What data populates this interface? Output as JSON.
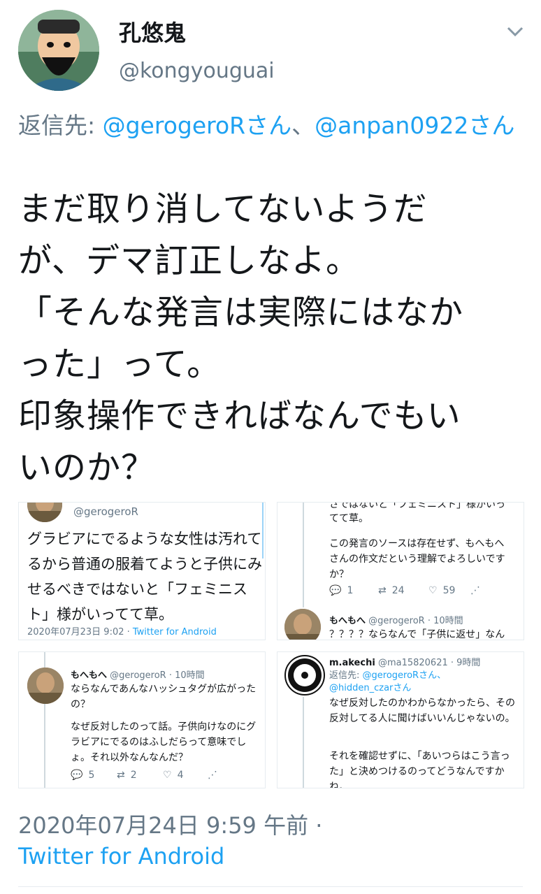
{
  "author": {
    "name": "孔悠鬼",
    "handle": "@kongyouguai"
  },
  "reply_to": {
    "prefix": "返信先: ",
    "mention1": "@gerogeroRさん",
    "sep": "、",
    "mention2": "@anpan0922さん"
  },
  "tweet_text": "まだ取り消してないようだ\nが、デマ訂正しなよ。\n「そんな発言は実際にはなか\nった」って。\n印象操作できればなんでもい\nいのか？",
  "images": {
    "top_left": {
      "handle": "@gerogeroR",
      "text": "グラビアにでるような女性は汚れてるから普通の服着てようと子供にみせるべきではないと「フェミニスト」様がいってて草。",
      "meta_date": "2020年07月23日 9:02 · ",
      "meta_source": "Twitter for Android"
    },
    "top_right": {
      "cut_line": "さではないと「フェミニスト」様がいっ",
      "line2": "てて草。",
      "body": "この発言のソースは存在せず、もへもへさんの作文だという理解でよろしいですか？",
      "replies": "1",
      "retweets": "24",
      "likes": "59",
      "next_name": "もへもへ",
      "next_meta": "@gerogeroR · 10時間",
      "next_text": "？？？？ならなんで「子供に返せ」なん"
    },
    "bottom_left": {
      "name": "もへもへ",
      "meta": "@gerogeroR · 10時間",
      "text1": "ならなんであんなハッシュタグが広がったの？",
      "text2": "なぜ反対したのって話。子供向けなのにグラビアにでるのはふしだらって意味でしょ。それ以外なんなんだ？",
      "replies": "5",
      "retweets": "2",
      "likes": "4"
    },
    "bottom_right": {
      "name": "m.akechi",
      "meta": "@ma15820621 · 9時間",
      "reply_prefix": "返信先: ",
      "reply_mention1": "@gerogeroRさん、",
      "reply_mention2": "@hidden_czarさん",
      "text1": "なぜ反対したのかわからなかったら、その反対してる人に聞けばいいんじゃないの。",
      "text2": "それを確認せずに、「あいつらはこう言った」と決めつけるのってどうなんですかね。"
    }
  },
  "timestamp": "2020年07月24日 9:59 午前 · ",
  "source": "Twitter for Android",
  "colors": {
    "accent": "#1da1f2",
    "muted": "#657786",
    "text": "#14171a"
  }
}
